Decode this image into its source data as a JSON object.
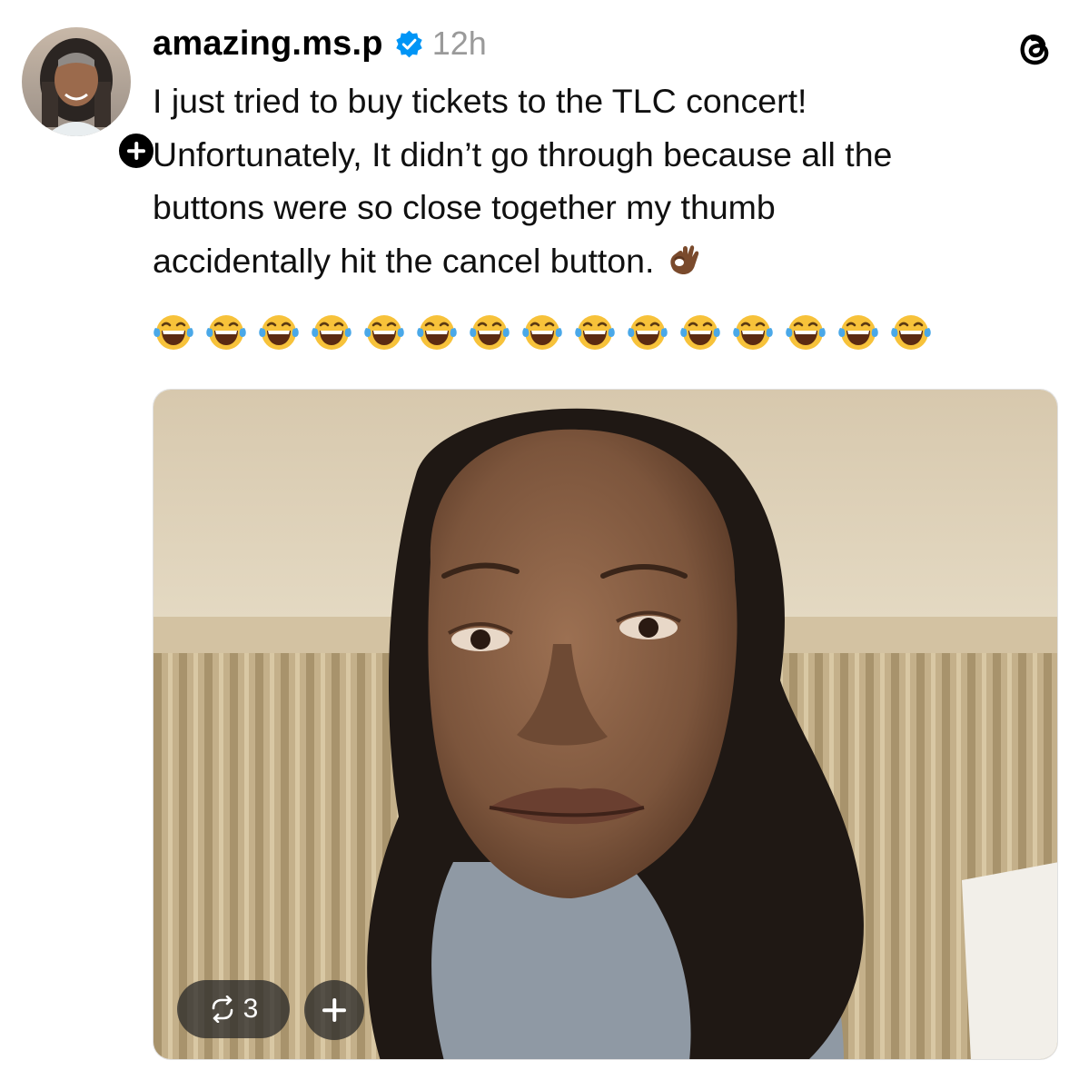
{
  "post": {
    "username": "amazing.ms.p",
    "verified": true,
    "timestamp": "12h",
    "text_lines": [
      "I just tried to buy tickets to the TLC concert!",
      "Unfortunately, It didn’t go through because all the",
      "buttons were so close together my thumb",
      "accidentally hit the cancel button."
    ],
    "text_trailing_emoji": "ok-hand-emoji",
    "laugh_emoji_count": 15
  },
  "media": {
    "repost_count": "3"
  },
  "icons": {
    "verified": "verified-badge-icon",
    "threads": "threads-logo-icon",
    "repost": "repost-icon",
    "add": "plus-icon",
    "follow": "plus-icon"
  },
  "colors": {
    "verified_blue": "#0095f6",
    "timestamp_gray": "#9a9a9a",
    "pill_bg": "#282828"
  }
}
